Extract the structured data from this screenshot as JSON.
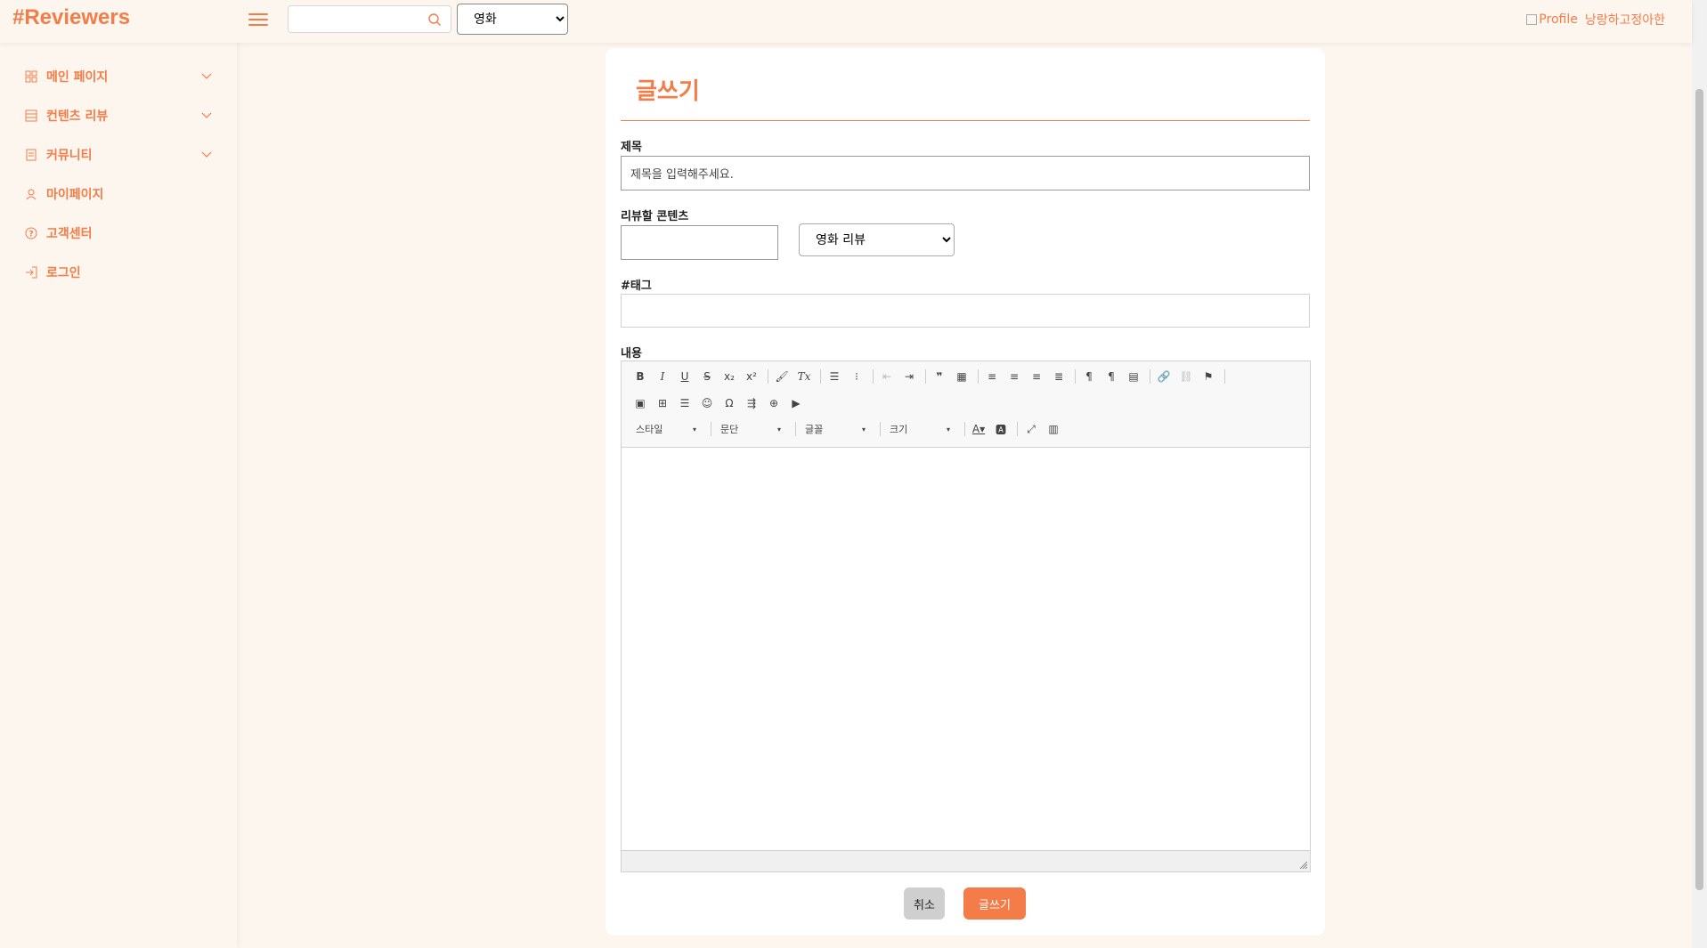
{
  "header": {
    "logo": "#Reviewers",
    "search_placeholder": "",
    "category_selected": "영화",
    "profile_alt": "Profile",
    "profile_name": "낭랑하고정아한"
  },
  "sidebar": {
    "items": [
      {
        "label": "메인 페이지",
        "icon": "grid-icon",
        "expandable": true
      },
      {
        "label": "컨텐츠 리뷰",
        "icon": "layout-icon",
        "expandable": true
      },
      {
        "label": "커뮤니티",
        "icon": "document-icon",
        "expandable": true
      },
      {
        "label": "마이페이지",
        "icon": "user-icon",
        "expandable": false
      },
      {
        "label": "고객센터",
        "icon": "help-circle-icon",
        "expandable": false
      },
      {
        "label": "로그인",
        "icon": "login-icon",
        "expandable": false
      }
    ]
  },
  "form": {
    "title": "글쓰기",
    "subject_label": "제목",
    "subject_value": "제목을 입력해주세요.",
    "content_label": "리뷰할 콘텐츠",
    "content_value": "",
    "review_type_selected": "영화 리뷰",
    "tag_label": "#태그",
    "tag_value": "",
    "body_label": "내용",
    "cancel_label": "취소",
    "submit_label": "글쓰기"
  },
  "editor": {
    "combos": {
      "style": "스타일",
      "format": "문단",
      "font": "글꼴",
      "size": "크기"
    }
  },
  "colors": {
    "accent": "#f47c48",
    "background": "#fdf6ef"
  }
}
